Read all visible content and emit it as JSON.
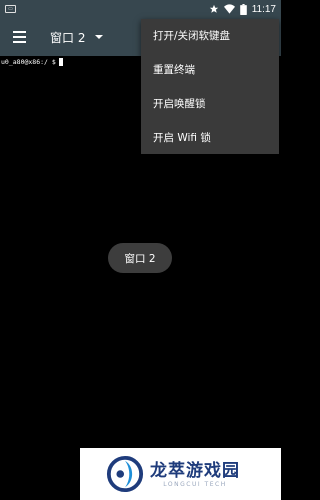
{
  "status_bar": {
    "notification_icon": "notification-icon",
    "icons": [
      "star-icon",
      "wifi-icon",
      "battery-icon"
    ],
    "time": "11:17"
  },
  "app_bar": {
    "menu_icon": "hamburger-menu-icon",
    "window_title": "窗口 2",
    "dropdown_icon": "dropdown-caret-icon"
  },
  "terminal": {
    "prompt": "u0_a80@x86:/ $"
  },
  "overflow_menu": {
    "items": [
      {
        "label": "打开/关闭软键盘"
      },
      {
        "label": "重置终端"
      },
      {
        "label": "开启唤醒锁"
      },
      {
        "label": "开启 Wifi 锁"
      }
    ]
  },
  "toast": {
    "text": "窗口 2"
  },
  "watermark": {
    "title": "龙萃游戏园",
    "subtitle": "LONGCUI TECH"
  },
  "colors": {
    "app_bar": "#37474f",
    "menu_bg": "#3a3a3a",
    "toast_bg": "#3d3d3d",
    "watermark_blue": "#1f3c7c"
  }
}
